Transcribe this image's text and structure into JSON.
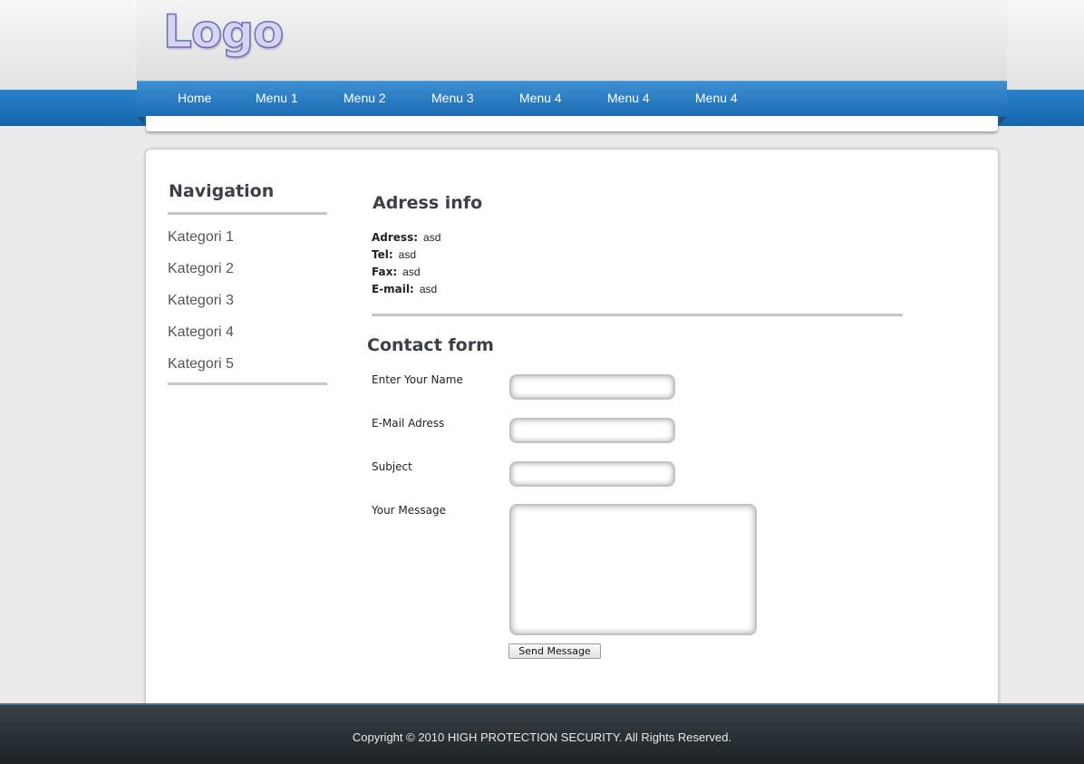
{
  "header": {
    "logo_text": "Logo"
  },
  "menu": [
    "Home",
    "Menu 1",
    "Menu 2",
    "Menu 3",
    "Menu 4",
    "Menu 4",
    "Menu 4"
  ],
  "sidebar": {
    "title": "Navigation",
    "items": [
      "Kategori 1",
      "Kategori 2",
      "Kategori 3",
      "Kategori 4",
      "Kategori 5"
    ]
  },
  "address": {
    "title": "Adress info",
    "rows": [
      {
        "label": "Adress:",
        "value": "asd"
      },
      {
        "label": "Tel:",
        "value": "asd"
      },
      {
        "label": "Fax:",
        "value": "asd"
      },
      {
        "label": "E-mail:",
        "value": "asd"
      }
    ]
  },
  "contact": {
    "title": "Contact form",
    "fields": {
      "name": {
        "label": "Enter Your Name",
        "value": ""
      },
      "email": {
        "label": "E-Mail Adress",
        "value": ""
      },
      "subject": {
        "label": "Subject",
        "value": ""
      },
      "message": {
        "label": "Your Message",
        "value": ""
      }
    },
    "send_label": "Send Message"
  },
  "footer": {
    "copyright": "Copyright © 2010 HIGH PROTECTION SECURITY. All Rights Reserved."
  },
  "colors": {
    "nav_blue": "#2a82c8",
    "footer_dark": "#2a3136",
    "heading": "#3b4148"
  }
}
